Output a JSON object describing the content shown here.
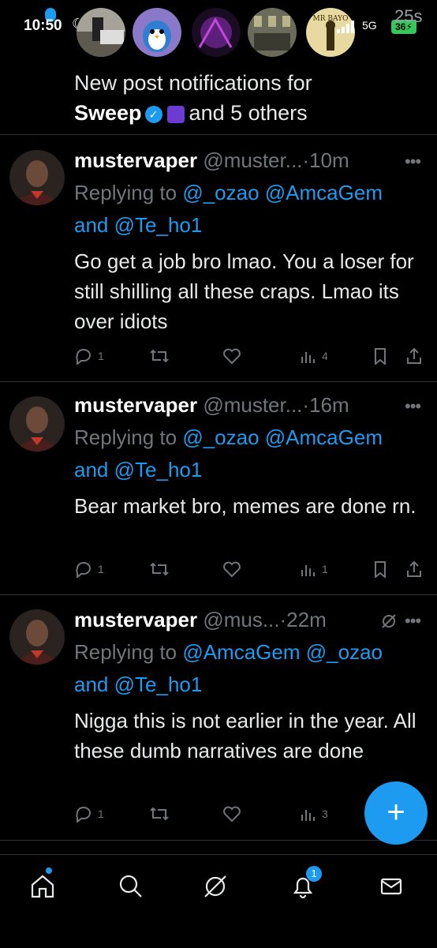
{
  "status": {
    "time": "10:50",
    "network": "5G",
    "battery": "36",
    "seconds": "25s"
  },
  "stories": [
    {
      "caption": ""
    },
    {
      "caption": ""
    },
    {
      "caption": ""
    },
    {
      "caption": ""
    },
    {
      "caption": "MR BAYO"
    }
  ],
  "notification": {
    "line1": "New post notifications for",
    "name": "Sweep",
    "rest": "and 5 others"
  },
  "posts": [
    {
      "name": "mustervaper",
      "handle": "@muster...",
      "time": "10m",
      "replying_prefix": "Replying to",
      "mention1": "@_ozao",
      "mention2": "@AmcaGem",
      "and_word": "and",
      "mention3": "@Te_ho1",
      "body": "Go get a job bro lmao. You a loser for still shilling all these craps. Lmao its over idiots",
      "replies": "1",
      "views": "4"
    },
    {
      "name": "mustervaper",
      "handle": "@muster...",
      "time": "16m",
      "replying_prefix": "Replying to",
      "mention1": "@_ozao",
      "mention2": "@AmcaGem",
      "and_word": "and",
      "mention3": "@Te_ho1",
      "body": "Bear market bro, memes are done rn.",
      "replies": "1",
      "views": "1"
    },
    {
      "name": "mustervaper",
      "handle": "@mus...",
      "time": "22m",
      "replying_prefix": "Replying to",
      "mention1": "@AmcaGem",
      "mention2": "@_ozao",
      "and_word": "and",
      "mention3": "@Te_ho1",
      "body": "Nigga this is not earlier in the year. All these dumb narratives are done",
      "replies": "1",
      "views": "3"
    }
  ],
  "fab": {
    "label": "+"
  },
  "tabs": {
    "notifications_badge": "1"
  },
  "colors": {
    "accent": "#1d9bf0",
    "muted": "#71767b",
    "background": "#000000"
  }
}
